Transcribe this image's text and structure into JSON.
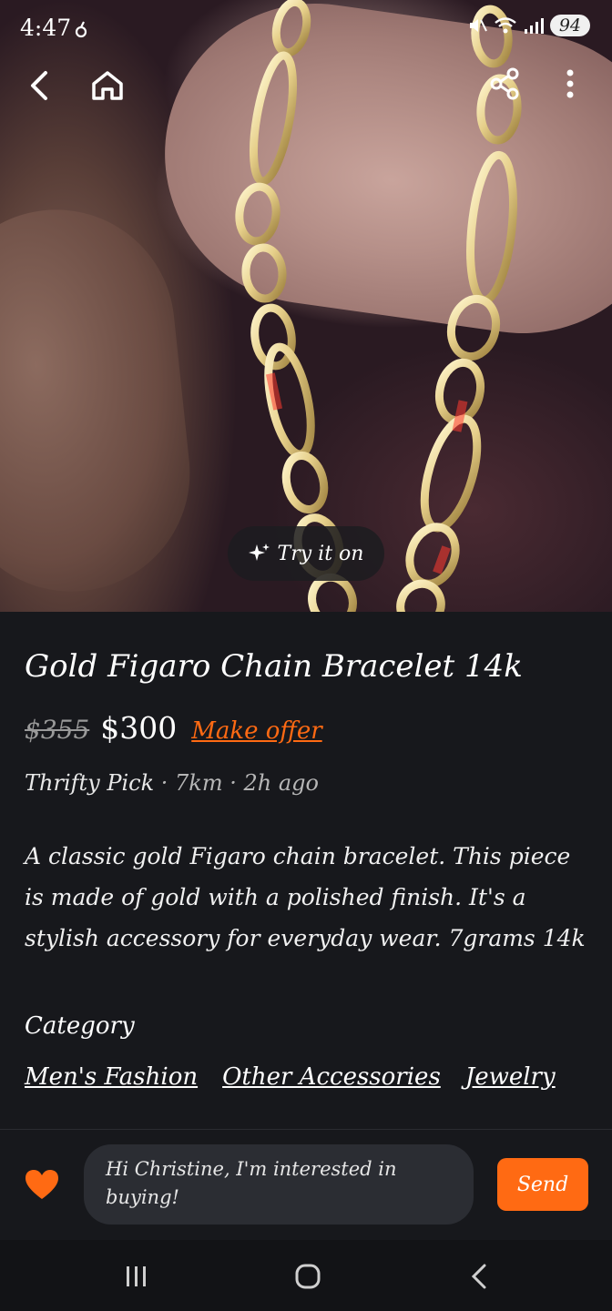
{
  "status_bar": {
    "time": "4:47",
    "battery": "94"
  },
  "hero": {
    "try_on_label": "Try it on"
  },
  "listing": {
    "title": "Gold Figaro Chain Bracelet 14k",
    "original_price": "$355",
    "price": "$300",
    "make_offer_label": "Make offer",
    "seller": "Thrifty Pick",
    "distance": " · 7km",
    "posted": " · 2h ago",
    "description": "A classic gold Figaro chain bracelet. This piece is made of gold with a polished finish. It's a stylish accessory for everyday wear. 7grams 14k",
    "category_label": "Category",
    "categories": [
      "Men's Fashion",
      "Other Accessories",
      "Jewelry"
    ]
  },
  "chat": {
    "message": "Hi Christine, I'm interested in buying!",
    "send_label": "Send"
  },
  "colors": {
    "accent": "#ff6a13",
    "background": "#17181c",
    "input_bg": "#2b2d33"
  },
  "icons": [
    "back-icon",
    "home-icon",
    "share-icon",
    "more-icon",
    "sparkle-icon",
    "heart-icon",
    "recent-apps-icon",
    "home-circle-icon",
    "nav-back-icon"
  ]
}
